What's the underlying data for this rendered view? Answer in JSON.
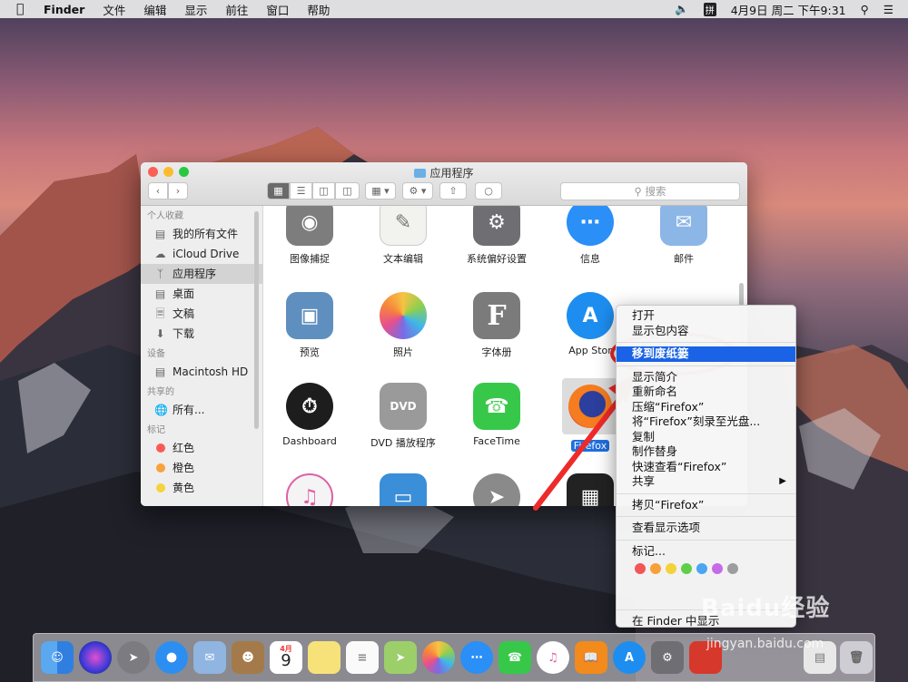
{
  "menubar": {
    "items": [
      "Finder",
      "文件",
      "编辑",
      "显示",
      "前往",
      "窗口",
      "帮助"
    ],
    "input_method": "拼",
    "clock": "4月9日 周二 下午9:31"
  },
  "window": {
    "title": "应用程序",
    "search_placeholder": "搜索"
  },
  "sidebar": {
    "favorites_header": "个人收藏",
    "favorites": [
      "我的所有文件",
      "iCloud Drive",
      "应用程序",
      "桌面",
      "文稿",
      "下载"
    ],
    "devices_header": "设备",
    "devices": [
      "Macintosh HD"
    ],
    "shared_header": "共享的",
    "shared": [
      "所有..."
    ],
    "tags_header": "标记",
    "tags": [
      {
        "label": "红色",
        "color": "#fa5a56"
      },
      {
        "label": "橙色",
        "color": "#f8a23b"
      },
      {
        "label": "黄色",
        "color": "#f5d33a"
      }
    ]
  },
  "apps": {
    "row1": [
      "图像捕捉",
      "文本编辑",
      "系统偏好设置",
      "信息",
      "邮件"
    ],
    "row2": [
      "预览",
      "照片",
      "字体册",
      "App Stor"
    ],
    "row3": [
      "Dashboard",
      "DVD 播放程序",
      "FaceTime",
      "Firefox"
    ]
  },
  "context_menu": {
    "items": [
      "打开",
      "显示包内容",
      "移到废纸篓",
      "显示简介",
      "重新命名",
      "压缩“Firefox”",
      "将“Firefox”刻录至光盘...",
      "复制",
      "制作替身",
      "快速查看“Firefox”",
      "共享",
      "拷贝“Firefox”",
      "查看显示选项",
      "标记...",
      "在 Finder 中显示"
    ],
    "highlighted": "移到废纸篓",
    "tag_colors": [
      "#f25757",
      "#f7a03a",
      "#f4d23a",
      "#5fcf4a",
      "#4aa6f2",
      "#c66be8",
      "#9d9d9d"
    ]
  },
  "dock": {
    "calendar_month": "4月",
    "calendar_day": "9"
  },
  "watermark": {
    "brand": "Baidu经验",
    "url": "jingyan.baidu.com"
  }
}
